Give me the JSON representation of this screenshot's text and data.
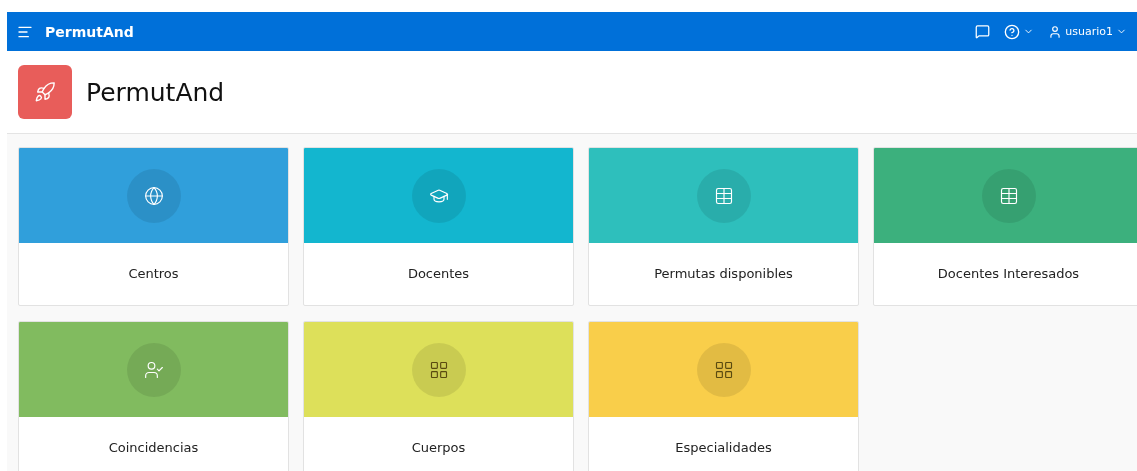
{
  "navbar": {
    "app_name": "PermutAnd",
    "user": "usuario1"
  },
  "header": {
    "title": "PermutAnd"
  },
  "tiles": [
    {
      "label": "Centros",
      "color": "#309fdb",
      "kind": "globe"
    },
    {
      "label": "Docentes",
      "color": "#13b6cf",
      "kind": "graduation"
    },
    {
      "label": "Permutas disponibles",
      "color": "#2ebfbc",
      "kind": "table"
    },
    {
      "label": "Docentes Interesados",
      "color": "#3cb07d",
      "kind": "table"
    },
    {
      "label": "Coincidencias",
      "color": "#81bb5f",
      "kind": "user-check"
    },
    {
      "label": "Cuerpos",
      "color": "#dde05a",
      "kind": "grid"
    },
    {
      "label": "Especialidades",
      "color": "#f9ce4a",
      "kind": "grid"
    }
  ]
}
